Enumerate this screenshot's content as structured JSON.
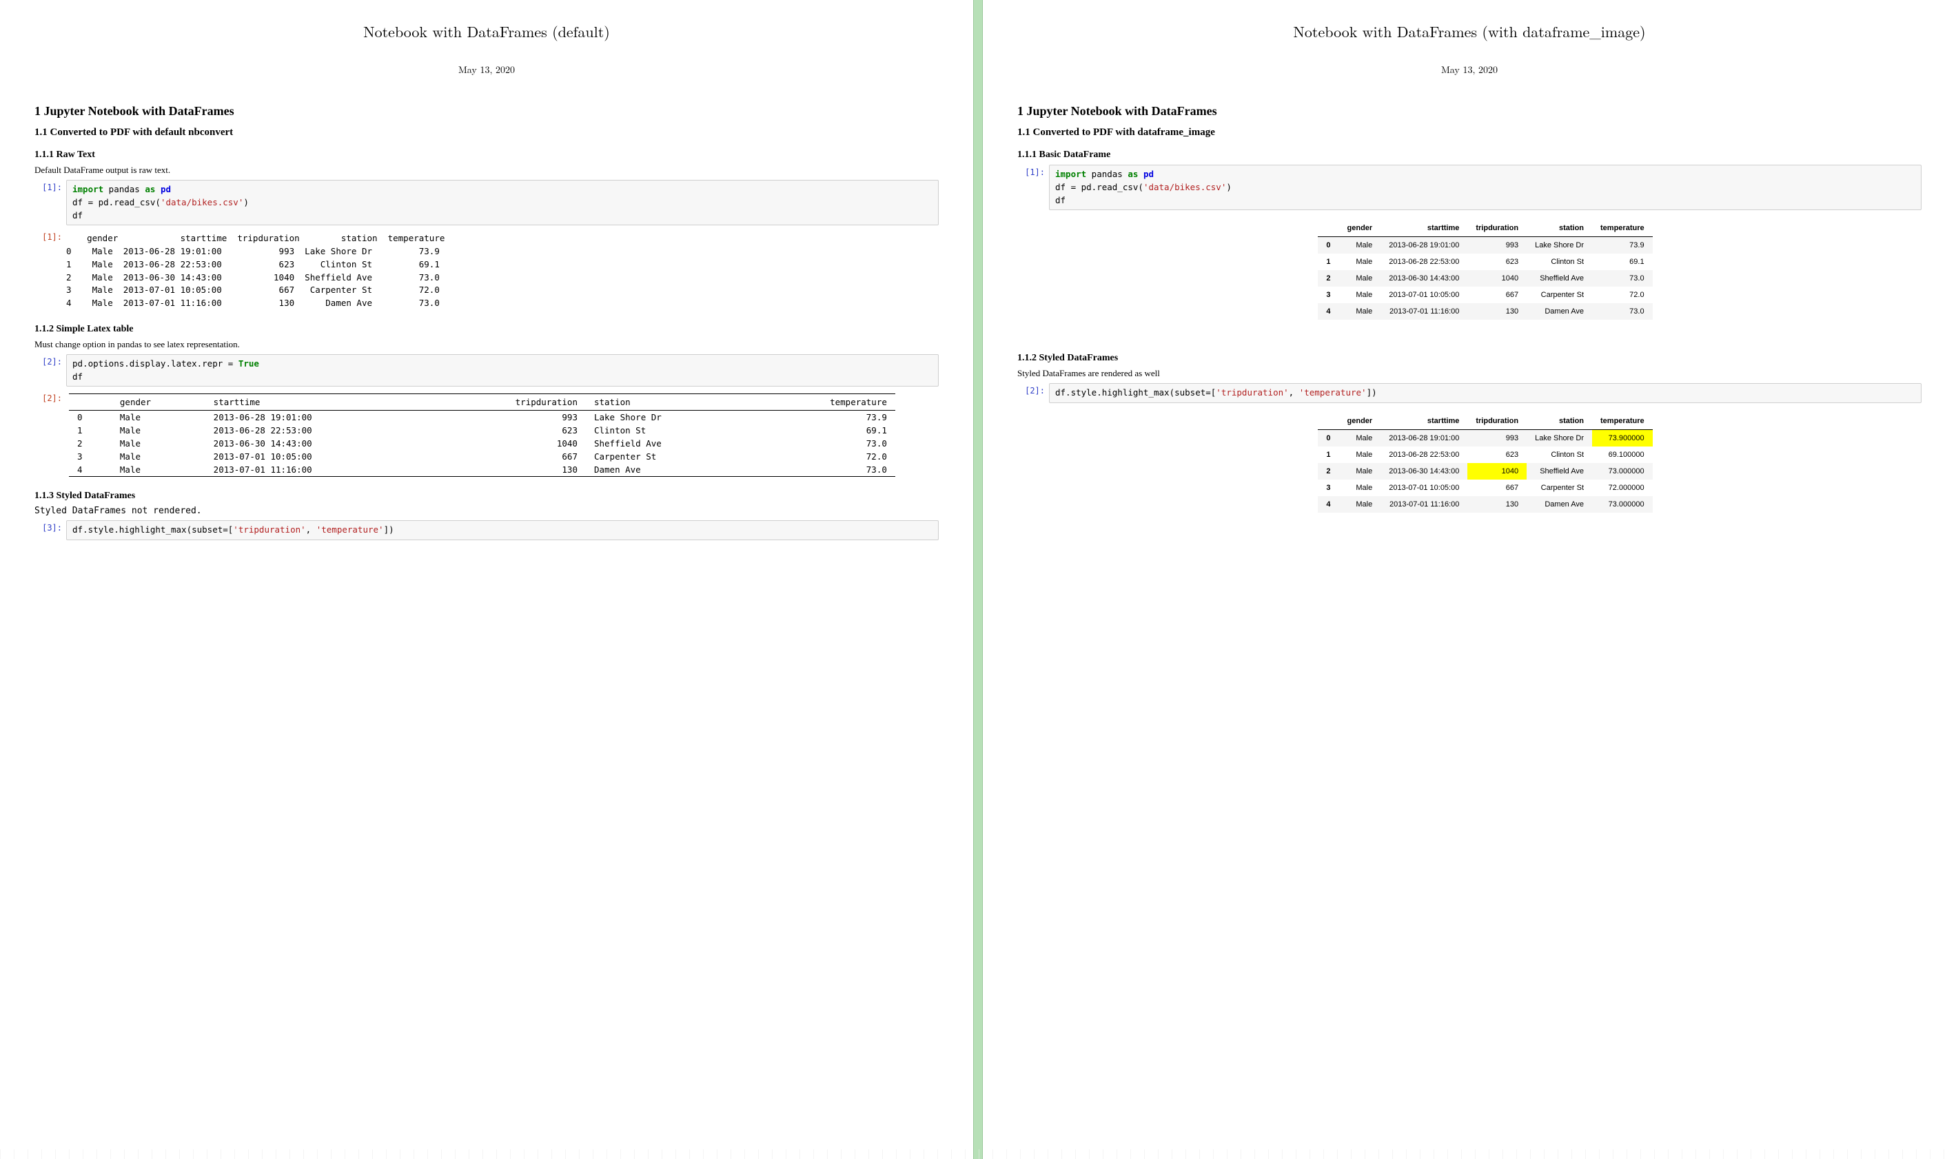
{
  "left": {
    "title": "Notebook with DataFrames (default)",
    "date": "May 13, 2020",
    "h1": "1   Jupyter Notebook with DataFrames",
    "h2": "1.1   Converted to PDF with default nbconvert",
    "sec1": {
      "heading": "1.1.1   Raw Text",
      "text": "Default DataFrame output is raw text.",
      "prompt_in": "[1]:",
      "code": {
        "l1a": "import",
        "l1b": " pandas ",
        "l1c": "as",
        "l1d": " pd",
        "l2a": "df = pd.read_csv(",
        "l2b": "'data/bikes.csv'",
        "l2c": ")",
        "l3": "df"
      },
      "prompt_out": "[1]:",
      "raw_header": "    gender            starttime  tripduration        station  temperature",
      "rows": [
        "0    Male  2013-06-28 19:01:00           993  Lake Shore Dr         73.9",
        "1    Male  2013-06-28 22:53:00           623     Clinton St         69.1",
        "2    Male  2013-06-30 14:43:00          1040  Sheffield Ave         73.0",
        "3    Male  2013-07-01 10:05:00           667   Carpenter St         72.0",
        "4    Male  2013-07-01 11:16:00           130      Damen Ave         73.0"
      ]
    },
    "sec2": {
      "heading": "1.1.2   Simple Latex table",
      "text": "Must change option in pandas to see latex representation.",
      "prompt_in": "[2]:",
      "code": {
        "l1a": "pd.options.display.latex.repr = ",
        "l1b": "True",
        "l2": "df"
      },
      "prompt_out": "[2]:",
      "cols": [
        "",
        "gender",
        "starttime",
        "tripduration",
        "station",
        "temperature"
      ],
      "rows": [
        [
          "0",
          "Male",
          "2013-06-28 19:01:00",
          "993",
          "Lake Shore Dr",
          "73.9"
        ],
        [
          "1",
          "Male",
          "2013-06-28 22:53:00",
          "623",
          "Clinton St",
          "69.1"
        ],
        [
          "2",
          "Male",
          "2013-06-30 14:43:00",
          "1040",
          "Sheffield Ave",
          "73.0"
        ],
        [
          "3",
          "Male",
          "2013-07-01 10:05:00",
          "667",
          "Carpenter St",
          "72.0"
        ],
        [
          "4",
          "Male",
          "2013-07-01 11:16:00",
          "130",
          "Damen Ave",
          "73.0"
        ]
      ]
    },
    "sec3": {
      "heading": "1.1.3   Styled DataFrames",
      "text": "Styled DataFrames not rendered.",
      "prompt_in": "[3]:",
      "code": {
        "l1a": "df.style.highlight_max(subset=[",
        "l1b": "'tripduration'",
        "l1c": ", ",
        "l1d": "'temperature'",
        "l1e": "])"
      }
    }
  },
  "right": {
    "title": "Notebook with DataFrames (with dataframe_image)",
    "date": "May 13, 2020",
    "h1": "1   Jupyter Notebook with DataFrames",
    "h2": "1.1   Converted to PDF with dataframe_image",
    "sec1": {
      "heading": "1.1.1   Basic DataFrame",
      "prompt_in": "[1]:",
      "code": {
        "l1a": "import",
        "l1b": " pandas ",
        "l1c": "as",
        "l1d": " pd",
        "l2a": "df = pd.read_csv(",
        "l2b": "'data/bikes.csv'",
        "l2c": ")",
        "l3": "df"
      },
      "cols": [
        "",
        "gender",
        "starttime",
        "tripduration",
        "station",
        "temperature"
      ],
      "rows": [
        [
          "0",
          "Male",
          "2013-06-28 19:01:00",
          "993",
          "Lake Shore Dr",
          "73.9"
        ],
        [
          "1",
          "Male",
          "2013-06-28 22:53:00",
          "623",
          "Clinton St",
          "69.1"
        ],
        [
          "2",
          "Male",
          "2013-06-30 14:43:00",
          "1040",
          "Sheffield Ave",
          "73.0"
        ],
        [
          "3",
          "Male",
          "2013-07-01 10:05:00",
          "667",
          "Carpenter St",
          "72.0"
        ],
        [
          "4",
          "Male",
          "2013-07-01 11:16:00",
          "130",
          "Damen Ave",
          "73.0"
        ]
      ]
    },
    "sec2": {
      "heading": "1.1.2   Styled DataFrames",
      "text": "Styled DataFrames are rendered as well",
      "prompt_in": "[2]:",
      "code": {
        "l1a": "df.style.highlight_max(subset=[",
        "l1b": "'tripduration'",
        "l1c": ", ",
        "l1d": "'temperature'",
        "l1e": "])"
      },
      "cols": [
        "",
        "gender",
        "starttime",
        "tripduration",
        "station",
        "temperature"
      ],
      "rows": [
        [
          "0",
          "Male",
          "2013-06-28 19:01:00",
          "993",
          "Lake Shore Dr",
          "73.900000"
        ],
        [
          "1",
          "Male",
          "2013-06-28 22:53:00",
          "623",
          "Clinton St",
          "69.100000"
        ],
        [
          "2",
          "Male",
          "2013-06-30 14:43:00",
          "1040",
          "Sheffield Ave",
          "73.000000"
        ],
        [
          "3",
          "Male",
          "2013-07-01 10:05:00",
          "667",
          "Carpenter St",
          "72.000000"
        ],
        [
          "4",
          "Male",
          "2013-07-01 11:16:00",
          "130",
          "Damen Ave",
          "73.000000"
        ]
      ],
      "hl": {
        "tripduration_row": 2,
        "temperature_row": 0
      }
    }
  }
}
